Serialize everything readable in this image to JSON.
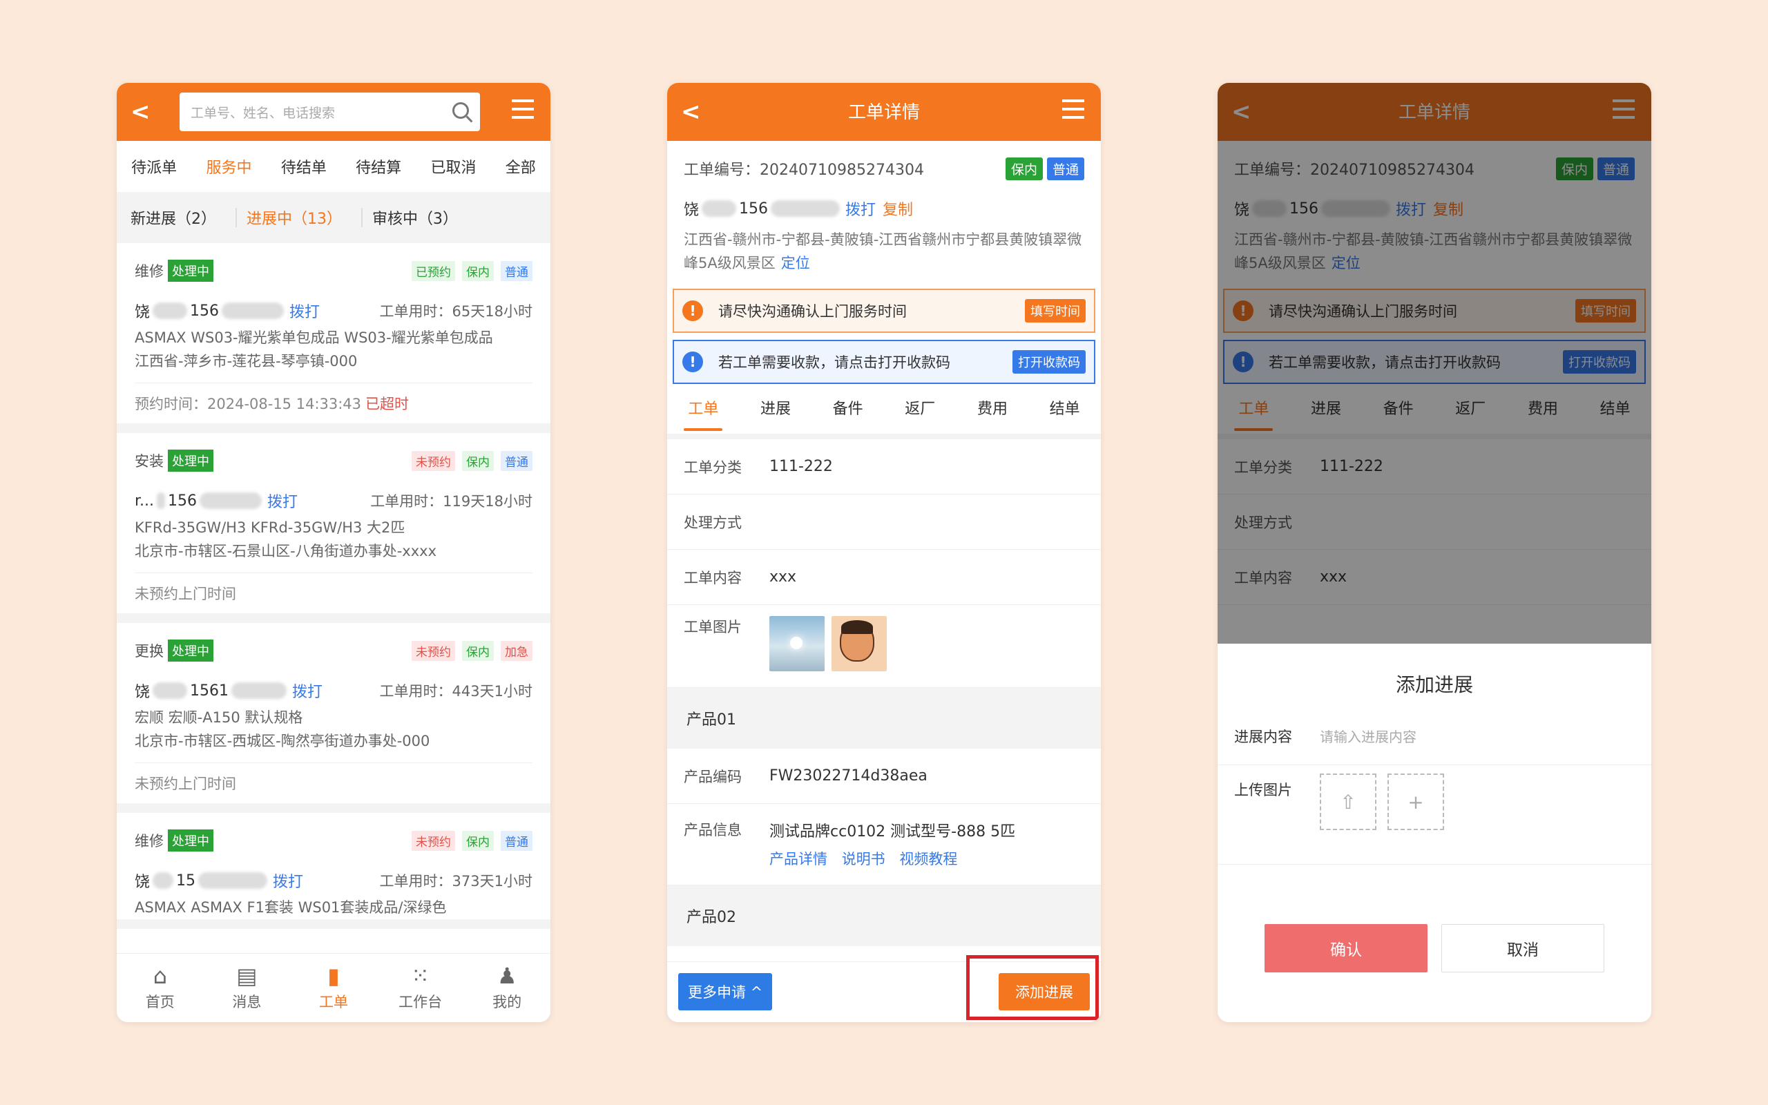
{
  "colors": {
    "accent": "#f4761f",
    "status_green": "#2aa236",
    "link_blue": "#3679e8",
    "confirm_red": "#f06d6d",
    "highlight_red": "#d8232a"
  },
  "list": {
    "search_placeholder": "工单号、姓名、电话搜索",
    "tabs": [
      "待派单",
      "服务中",
      "待结单",
      "待结算",
      "已取消",
      "全部"
    ],
    "subtabs": [
      "新进展（2）",
      "进展中（13）",
      "审核中（3）"
    ],
    "cards": [
      {
        "type": "维修",
        "status": "处理中",
        "badges": [
          "已预约",
          "保内",
          "普通"
        ],
        "name": "饶",
        "phone": "156",
        "dial": "拨打",
        "used": "工单用时：65天18小时",
        "product": "ASMAX WS03-耀光紫单包成品 WS03-耀光紫单包成品",
        "address": "江西省-萍乡市-莲花县-琴亭镇-000",
        "appt": "预约时间：2024-08-15 14:33:43",
        "late": "已超时"
      },
      {
        "type": "安装",
        "status": "处理中",
        "badges": [
          "未预约",
          "保内",
          "普通"
        ],
        "name": "r...",
        "phone": "156",
        "dial": "拨打",
        "used": "工单用时：119天18小时",
        "product": "KFRd-35GW/H3 KFRd-35GW/H3 大2匹",
        "address": "北京市-市辖区-石景山区-八角街道办事处-xxxx",
        "appt": "未预约上门时间"
      },
      {
        "type": "更换",
        "status": "处理中",
        "badges": [
          "未预约",
          "保内",
          "加急"
        ],
        "name": "饶",
        "phone": "1561",
        "dial": "拨打",
        "used": "工单用时：443天1小时",
        "product": "宏顺 宏顺-A150 默认规格",
        "address": "北京市-市辖区-西城区-陶然亭街道办事处-000",
        "appt": "未预约上门时间"
      },
      {
        "type": "维修",
        "status": "处理中",
        "badges": [
          "未预约",
          "保内",
          "普通"
        ],
        "name": "饶",
        "phone": "15",
        "dial": "拨打",
        "used": "工单用时：373天1小时",
        "product": "ASMAX ASMAX F1套装 WS01套装成品/深绿色"
      }
    ],
    "nav": [
      {
        "icon": "⌂",
        "label": "首页"
      },
      {
        "icon": "▤",
        "label": "消息"
      },
      {
        "icon": "▮",
        "label": "工单"
      },
      {
        "icon": "⁙",
        "label": "工作台"
      },
      {
        "icon": "♟",
        "label": "我的"
      }
    ]
  },
  "detail": {
    "title": "工单详情",
    "order_no": "工单编号：20240710985274304",
    "tags": [
      "保内",
      "普通"
    ],
    "name": "饶",
    "phone": "156",
    "dial": "拨打",
    "copy": "复制",
    "address": "江西省-赣州市-宁都县-黄陂镇-江西省赣州市宁都县黄陂镇翠微峰5A级风景区",
    "locate": "定位",
    "alert1": "请尽快沟通确认上门服务时间",
    "alert1_btn": "填写时间",
    "alert2": "若工单需要收款，请点击打开收款码",
    "alert2_btn": "打开收款码",
    "tabs": [
      "工单",
      "进展",
      "备件",
      "返厂",
      "费用",
      "结单"
    ],
    "fields": {
      "cat_label": "工单分类",
      "cat_val": "111-222",
      "method_label": "处理方式",
      "content_label": "工单内容",
      "content_val": "xxx",
      "img_label": "工单图片"
    },
    "product1": "产品01",
    "code_label": "产品编码",
    "code_val": "FW23022714d38aea",
    "pinfo_label": "产品信息",
    "pinfo_val": "测试品牌cc0102 测试型号-888 5匹",
    "links": [
      "产品详情",
      "说明书",
      "视频教程"
    ],
    "product2": "产品02",
    "more_btn": "更多申请 ^",
    "add_btn": "添加进展"
  },
  "sheet": {
    "title": "添加进展",
    "content_label": "进展内容",
    "content_placeholder": "请输入进展内容",
    "upload_label": "上传图片",
    "confirm": "确认",
    "cancel": "取消"
  }
}
